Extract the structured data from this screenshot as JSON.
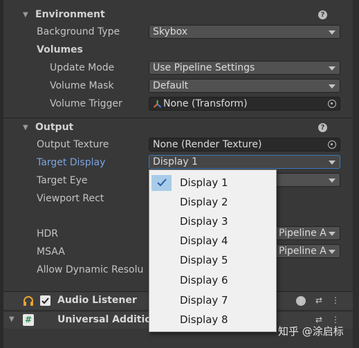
{
  "environment": {
    "title": "Environment",
    "help": "?",
    "background_type": {
      "label": "Background Type",
      "value": "Skybox"
    },
    "volumes_label": "Volumes",
    "update_mode": {
      "label": "Update Mode",
      "value": "Use Pipeline Settings"
    },
    "volume_mask": {
      "label": "Volume Mask",
      "value": "Default"
    },
    "volume_trigger": {
      "label": "Volume Trigger",
      "value": "None (Transform)"
    }
  },
  "output": {
    "title": "Output",
    "help": "?",
    "output_texture": {
      "label": "Output Texture",
      "value": "None (Render Texture)"
    },
    "target_display": {
      "label": "Target Display",
      "value": "Display 1"
    },
    "target_eye": {
      "label": "Target Eye"
    },
    "viewport_rect": {
      "label": "Viewport Rect"
    },
    "hdr": {
      "label": "HDR",
      "value": "Pipeline A"
    },
    "msaa": {
      "label": "MSAA",
      "value": "Pipeline A"
    },
    "allow_dynamic": {
      "label": "Allow Dynamic Resolu"
    }
  },
  "components": {
    "audio_listener": {
      "title": "Audio Listener",
      "checked": true
    },
    "universal_additional": {
      "title": "Universal Addition"
    }
  },
  "popup": {
    "items": [
      "Display 1",
      "Display 2",
      "Display 3",
      "Display 4",
      "Display 5",
      "Display 6",
      "Display 7",
      "Display 8"
    ],
    "selected_index": 0
  },
  "watermark": "知乎 @涂启标",
  "colors": {
    "focus_label": "#7ba3e0",
    "selection_highlight": "#a8cce8",
    "panel_bg": "#383838"
  }
}
